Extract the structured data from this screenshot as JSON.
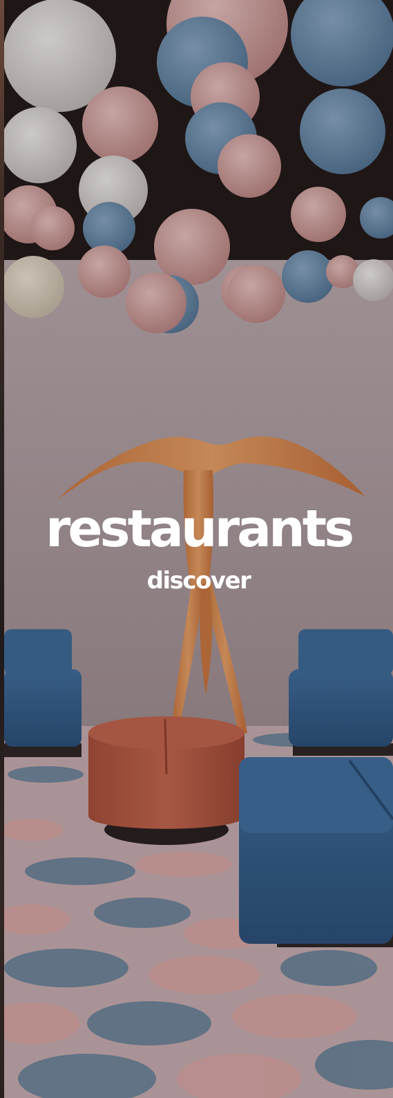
{
  "hero": {
    "title": "restaurants",
    "cta_label": "discover",
    "scene": "restaurant-interior-image"
  },
  "colors": {
    "text": "#ffffff",
    "lantern_pink": "#d9a9a6",
    "lantern_blue": "#6a8fb0",
    "lantern_white": "#e6e4e2",
    "sofa_blue": "#2f5e8e",
    "ottoman_orange": "#b5583f",
    "sculpture_orange": "#d9894a",
    "wall": "#a8979a",
    "ceiling": "#1e1514"
  }
}
